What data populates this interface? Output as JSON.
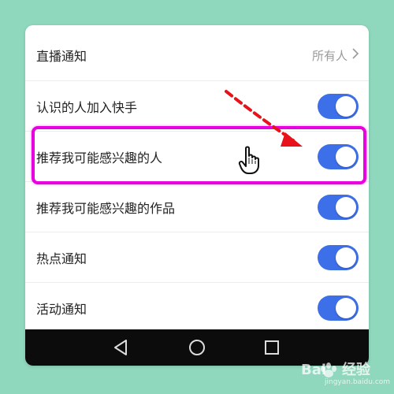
{
  "settings": {
    "rows": [
      {
        "label": "直播通知",
        "value": "所有人"
      },
      {
        "label": "认识的人加入快手",
        "toggle_on": true
      },
      {
        "label": "推荐我可能感兴趣的人",
        "toggle_on": true
      },
      {
        "label": "推荐我可能感兴趣的作品",
        "toggle_on": true
      },
      {
        "label": "热点通知",
        "toggle_on": true
      },
      {
        "label": "活动通知",
        "toggle_on": true
      }
    ]
  },
  "navbar": {
    "buttons": [
      "back-icon",
      "home-icon",
      "recent-apps-icon"
    ]
  },
  "annotation": {
    "highlight_color": "#e800e0",
    "arrow_color": "#e8121a",
    "cursor": "hand-pointer-icon"
  },
  "watermark": {
    "brand": "Bai",
    "brand_cn": "经验",
    "url": "jingyan.baidu.com"
  },
  "colors": {
    "background": "#8fd8bd",
    "toggle_on": "#3d6fe8",
    "navbar": "#0c0c0c"
  }
}
